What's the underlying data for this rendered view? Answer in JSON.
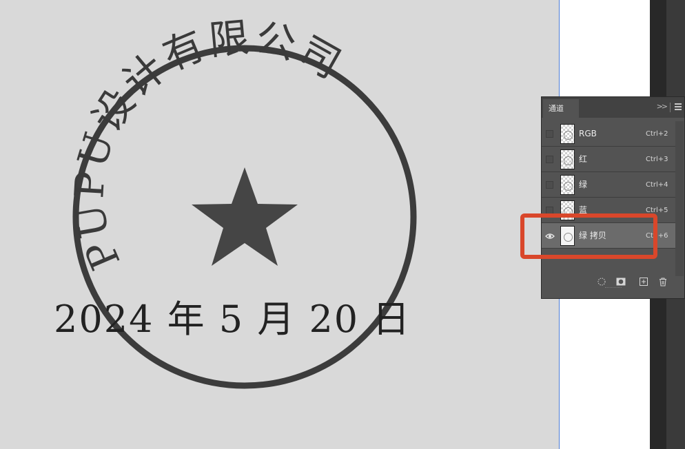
{
  "stamp": {
    "company_text": "PUPU设计有限公司",
    "date_text": "2024 年 5 月 20 日"
  },
  "channels_panel": {
    "tab_label": "通道",
    "channels": [
      {
        "name": "RGB",
        "shortcut": "Ctrl+2",
        "visible": false,
        "selected": false
      },
      {
        "name": "红",
        "shortcut": "Ctrl+3",
        "visible": false,
        "selected": false
      },
      {
        "name": "绿",
        "shortcut": "Ctrl+4",
        "visible": false,
        "selected": false
      },
      {
        "name": "蓝",
        "shortcut": "Ctrl+5",
        "visible": false,
        "selected": false
      },
      {
        "name": "绿 拷贝",
        "shortcut": "Ctrl+6",
        "visible": true,
        "selected": true
      }
    ],
    "footer_icons": [
      "load-selection-icon",
      "save-selection-icon",
      "new-channel-icon",
      "delete-channel-icon"
    ]
  },
  "annotation": {
    "color": "#d9472b"
  }
}
